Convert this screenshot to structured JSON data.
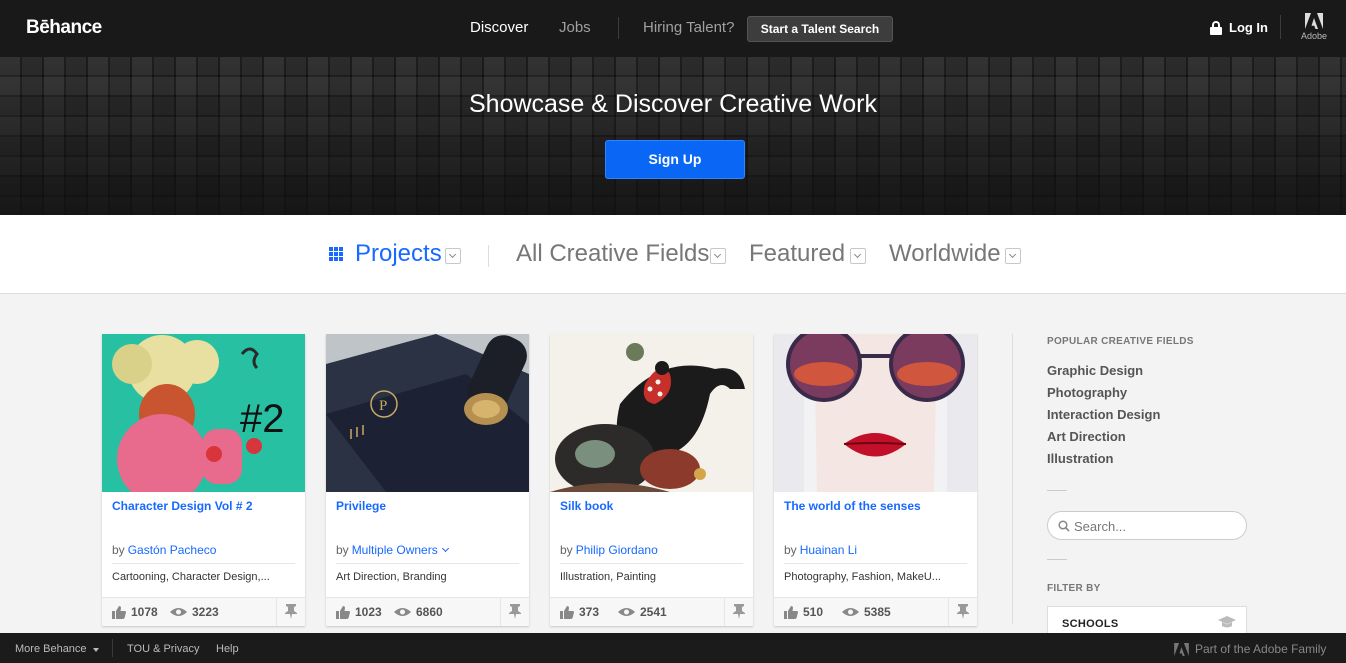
{
  "header": {
    "logo": "Bēhance",
    "nav": {
      "discover": "Discover",
      "jobs": "Jobs",
      "hiring": "Hiring Talent?"
    },
    "talent_search_button": "Start a Talent Search",
    "login": "Log In",
    "adobe_label": "Adobe"
  },
  "hero": {
    "title": "Showcase & Discover Creative Work",
    "signup_button": "Sign Up"
  },
  "filters": {
    "projects": "Projects",
    "fields": "All Creative Fields",
    "featured": "Featured",
    "location": "Worldwide"
  },
  "projects": [
    {
      "title": "Character Design Vol # 2",
      "by": "by",
      "owner": "Gastón Pacheco",
      "fields": "Cartooning, Character Design,...",
      "appreciations": "1078",
      "views": "3223"
    },
    {
      "title": "Privilege",
      "by": "by",
      "owner": "Multiple Owners",
      "fields": "Art Direction, Branding",
      "appreciations": "1023",
      "views": "6860"
    },
    {
      "title": "Silk book",
      "by": "by",
      "owner": "Philip Giordano",
      "fields": "Illustration, Painting",
      "appreciations": "373",
      "views": "2541"
    },
    {
      "title": "The world of the senses",
      "by": "by",
      "owner": "Huainan Li",
      "fields": "Photography, Fashion, MakeU...",
      "appreciations": "510",
      "views": "5385"
    }
  ],
  "sidebar": {
    "popular_heading": "POPULAR CREATIVE FIELDS",
    "popular_fields": [
      "Graphic Design",
      "Photography",
      "Interaction Design",
      "Art Direction",
      "Illustration"
    ],
    "search_placeholder": "Search...",
    "filter_heading": "FILTER BY",
    "schools_label": "SCHOOLS"
  },
  "footer": {
    "more": "More Behance",
    "tou": "TOU & Privacy",
    "help": "Help",
    "family": "Part of the Adobe Family"
  },
  "colors": {
    "accent": "#1769ff",
    "signup": "#0a67f5",
    "topbar": "#191919",
    "footer": "#1b1b1b"
  },
  "icons": [
    "lock-icon",
    "adobe-logo-icon",
    "grid-icon",
    "chevron-down-icon",
    "thumbs-up-icon",
    "eye-icon",
    "save-icon",
    "search-icon",
    "graduation-cap-icon"
  ]
}
